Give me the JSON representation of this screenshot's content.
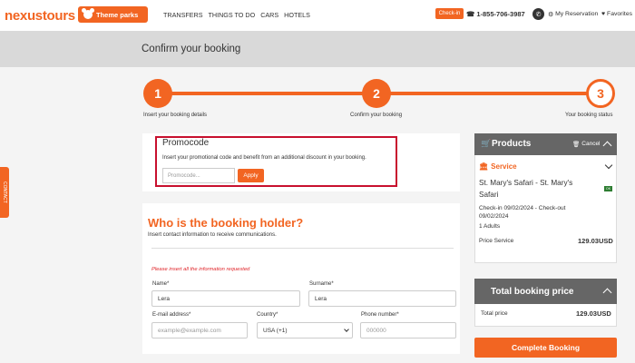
{
  "header": {
    "logo": "nexustours",
    "theme_parks": "Theme parks",
    "nav": [
      "TRANSFERS",
      "THINGS TO DO",
      "CARS",
      "HOTELS"
    ],
    "checkin": "Check-in",
    "phone": "1-855-706-3987",
    "my_reservation": "My Reservation",
    "favorites": "Favorites"
  },
  "page_title": "Confirm your booking",
  "side_tab": "CONTACT",
  "steps": [
    {
      "number": "1",
      "label": "Insert your booking details"
    },
    {
      "number": "2",
      "label": "Confirm your booking"
    },
    {
      "number": "3",
      "label": "Your booking status"
    }
  ],
  "promo": {
    "title": "Promocode",
    "description": "Insert your promotional code and benefit from an additional discount in your booking.",
    "placeholder": "Promocode...",
    "apply": "Apply"
  },
  "holder": {
    "title": "Who is the booking holder?",
    "subtitle": "Insert contact information to receive communications.",
    "warning": "Please insert all the information requested",
    "name_label": "Name*",
    "name_value": "Lera",
    "surname_label": "Surname*",
    "surname_value": "Lera",
    "email_label": "E-mail address*",
    "email_placeholder": "example@example.com",
    "country_label": "Country*",
    "country_value": "USA (+1)",
    "phone_label": "Phone number*",
    "phone_placeholder": "000000"
  },
  "products": {
    "title": "Products",
    "cancel": "Cancel",
    "service_label": "Service",
    "service_name": "St. Mary's Safari - St. Mary's Safari",
    "ok_badge": "OK",
    "dates": "Check-in 09/02/2024 - Check-out 09/02/2024",
    "adults": "1 Adults",
    "price_label": "Price Service",
    "price_value": "129.03USD"
  },
  "total": {
    "title": "Total booking price",
    "label": "Total price",
    "value": "129.03USD"
  },
  "complete_button": "Complete Booking",
  "colors": {
    "accent": "#f26522",
    "highlight_border": "#c8102e",
    "panel_header": "#666666",
    "warning": "#e0262b"
  }
}
